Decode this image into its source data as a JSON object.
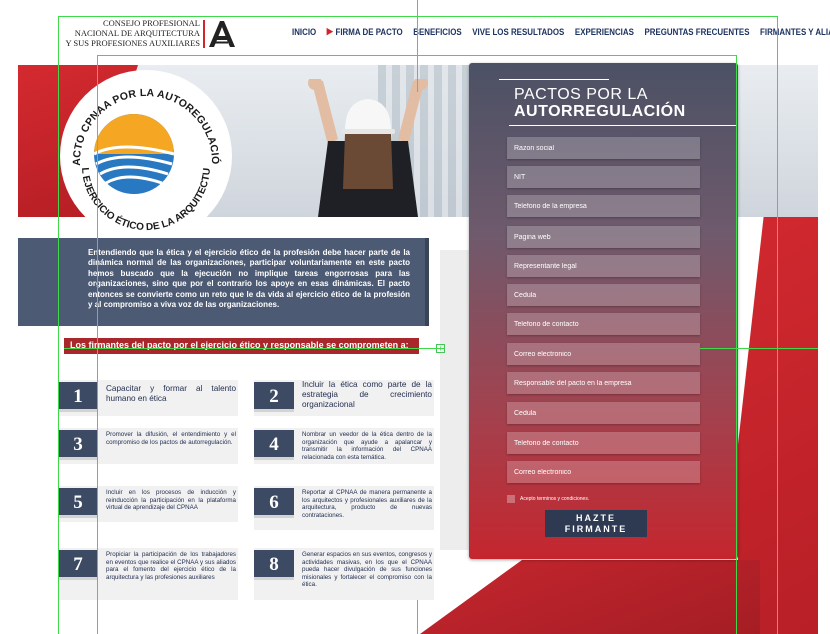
{
  "org": {
    "name_lines": [
      "CONSEJO PROFESIONAL",
      "NACIONAL DE ARQUITECTURA",
      "Y SUS PROFESIONES AUXILIARES"
    ],
    "logo_letter": "A"
  },
  "nav": {
    "items": [
      "INICIO",
      "FIRMA DE PACTO",
      "BENEFICIOS",
      "VIVE LOS RESULTADOS",
      "EXPERIENCIAS",
      "PREGUNTAS FRECUENTES",
      "FIRMANTES Y ALIADOS"
    ],
    "active_marker_icon": "play-arrow-icon"
  },
  "emblem": {
    "top_text": "PACTO CPNAA POR LA AUTOREGULACIÓN",
    "bottom_text": "DEL EJERCICIO ÉTICO DE LA ARQUITECTURA"
  },
  "intro": {
    "text": "Entendiendo que la ética y el ejercicio ético de la profesión debe hacer parte de la dinámica normal de las organizaciones, participar voluntariamente en este pacto hemos buscado que la ejecución no implique tareas engorrosas para las organizaciones, sino que por el contrario los apoye en esas dinámicas. El pacto entonces se convierte como un reto que le da vida al ejercicio ético de la profesión y al compromiso a viva voz de las organizaciones."
  },
  "commitments": {
    "heading": "Los firmantes del pacto por el ejercicio ético y responsable se comprometen a:",
    "plus_label": "+",
    "items": [
      {
        "num": "1",
        "text": "Capacitar y formar al talento humano en ética"
      },
      {
        "num": "2",
        "text": "Incluir la ética como parte de la estrategia de crecimiento organizacional"
      },
      {
        "num": "3",
        "text": "Promover la difusión, el entendimiento y el compromiso de los pactos de autorregulación."
      },
      {
        "num": "4",
        "text": "Nombrar un veedor de la ética dentro de la organización que ayude a apalancar y transmitir la información del CPNAA relacionada con esta temática."
      },
      {
        "num": "5",
        "text": "Incluir en los procesos de inducción y reinducción la participación en la plataforma virtual de aprendizaje del CPNAA"
      },
      {
        "num": "6",
        "text": "Reportar al CPNAA de manera permanente a los arquitectos y profesionales auxiliares de la arquitectura, producto de nuevas contrataciones."
      },
      {
        "num": "7",
        "text": "Propiciar la participación de los trabajadores en eventos que realice el CPNAA y sus aliados para el fomento del ejercicio ético de la arquitectura y las profesiones auxiliares"
      },
      {
        "num": "8",
        "text": "Generar espacios en sus eventos, congresos y actividades masivas, en los que el CPNAA pueda hacer divulgación de sus funciones misionales y fortalecer el compromiso con la ética."
      }
    ]
  },
  "form": {
    "title_line1": "PACTOS POR LA",
    "title_line2": "AUTORREGULACIÓN",
    "fields": [
      "Razon social",
      "NIT",
      "Telefono de la empresa",
      "Pagina web",
      "Representante legal",
      "Cedula",
      "Telefono de contacto",
      "Correo electronico",
      "Responsable del pacto en la empresa",
      "Cedula",
      "Telefono de contacto",
      "Correo electronico"
    ],
    "terms_label": "Acepto terminos y condiciones.",
    "submit_line1": "HAZTE",
    "submit_line2": "FIRMANTE"
  },
  "colors": {
    "brand_red": "#d2232a",
    "navy": "#1d3361",
    "slate": "#4d5a73",
    "guide_green": "#3fd94a"
  }
}
